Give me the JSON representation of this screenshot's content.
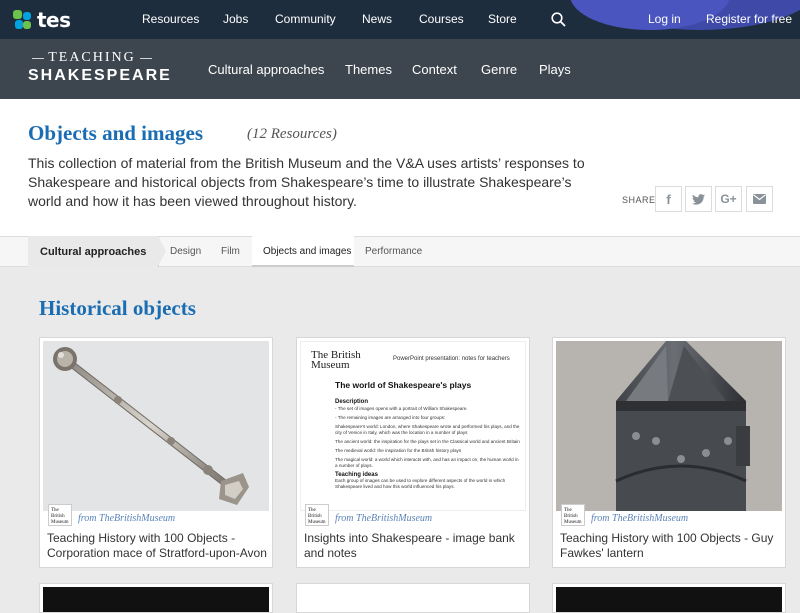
{
  "topnav": {
    "brand": "tes",
    "items": [
      "Resources",
      "Jobs",
      "Community",
      "News",
      "Courses",
      "Store"
    ],
    "login": "Log in",
    "register": "Register for free"
  },
  "subnav": {
    "brand_line1": "TEACHING",
    "brand_line2": "SHAKESPEARE",
    "items": [
      "Cultural approaches",
      "Themes",
      "Context",
      "Genre",
      "Plays"
    ]
  },
  "header": {
    "title": "Objects and images",
    "count": "(12 Resources)",
    "description": "This collection of material from the British Museum and the V&A uses artists’ responses to Shakespeare and historical objects from Shakespeare’s time to illustrate Shakespeare’s world and how it has been viewed throughout history.",
    "share_label": "SHARE",
    "share_buttons": [
      "f",
      "t",
      "G+",
      "mail"
    ]
  },
  "tabs": {
    "parent": "Cultural approaches",
    "items": [
      "Design",
      "Film",
      "Objects and images",
      "Performance"
    ]
  },
  "section": {
    "title": "Historical objects"
  },
  "cards": [
    {
      "from": "from TheBritishMuseum",
      "logo": "The British Museum",
      "title": "Teaching History with 100 Objects - Corporation mace of Stratford-upon-Avon"
    },
    {
      "from": "from TheBritishMuseum",
      "logo": "The British Museum",
      "title": "Insights into Shakespeare - image bank and notes",
      "doc": {
        "brand": "The British Museum",
        "header_note": "PowerPoint presentation: notes for teachers",
        "heading": "The world of Shakespeare's plays",
        "desc_label": "Description",
        "lines": [
          "- The set of images opens with a portrait of William Shakespeare.",
          "- The remaining images are arranged into four groups:",
          "Shakespeare's world: London, where Shakespeare wrote and performed his plays, and the city of Venice in Italy, which was the location in a number of plays",
          "The ancient world: the inspiration for the plays set in the Classical world and ancient Britain",
          "The medieval world: the inspiration for the British history plays",
          "The magical world: a world which interacts with, and has an impact on, the human world in a number of plays."
        ],
        "ideas_label": "Teaching ideas",
        "ideas_text": "Each group of images can be used to explore different aspects of the world in which Shakespeare lived and how this world influenced his plays."
      }
    },
    {
      "from": "from TheBritishMuseum",
      "logo": "The British Museum",
      "title": "Teaching History with 100 Objects - Guy Fawkes' lantern"
    }
  ],
  "colors": {
    "topnav_bg": "#1e2d3e",
    "subnav_bg": "#3d464f",
    "title_blue": "#1a6db3",
    "link_blue": "#5a83b8"
  },
  "icons": [
    "tes-logo-icon",
    "search-icon",
    "facebook-icon",
    "twitter-icon",
    "google-plus-icon",
    "mail-icon"
  ]
}
